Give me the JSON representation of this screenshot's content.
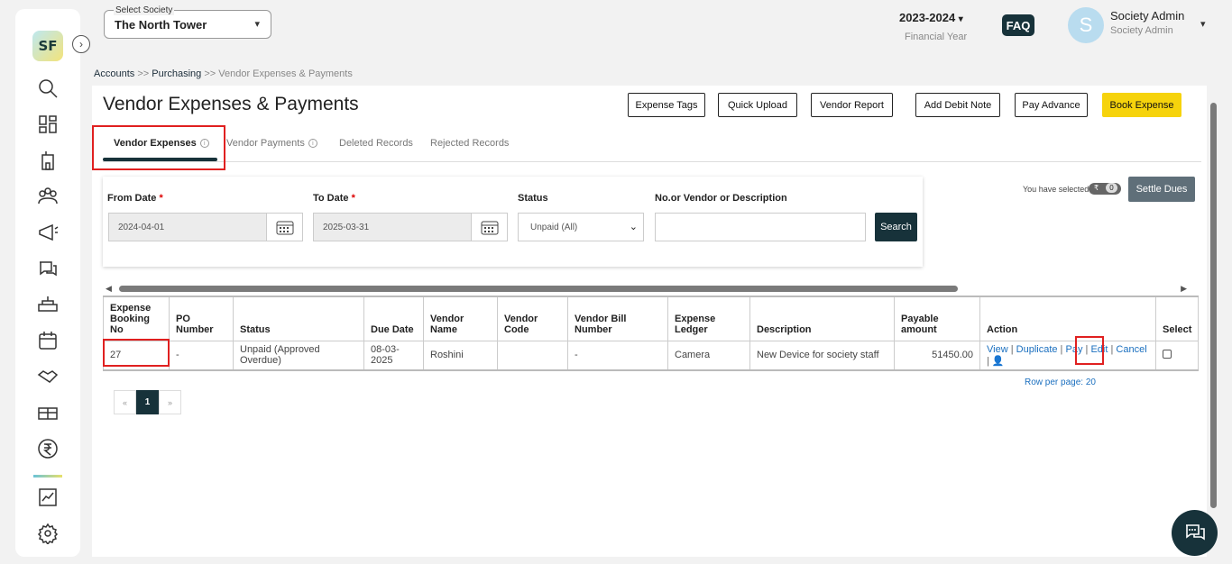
{
  "header": {
    "society_label": "Select Society",
    "society_value": "The North Tower",
    "financial_year": "2023-2024",
    "financial_year_label": "Financial Year",
    "faq_label": "FAQ",
    "avatar_letter": "S",
    "user_name": "Society Admin",
    "user_role": "Society Admin"
  },
  "sidebar": {
    "logo_text": "SF",
    "items": [
      "search-icon",
      "dashboard-icon",
      "building-icon",
      "members-icon",
      "announcement-icon",
      "complaints-icon",
      "facility-icon",
      "calendar-icon",
      "vendors-icon",
      "assets-icon",
      "accounts-icon",
      "reports-icon",
      "settings-icon"
    ]
  },
  "breadcrumb": {
    "accounts": "Accounts",
    "sep1": ">>",
    "purchasing": "Purchasing",
    "sep2": ">>",
    "current": "Vendor Expenses & Payments"
  },
  "page": {
    "title": "Vendor Expenses & Payments",
    "buttons": {
      "expense_tags": "Expense Tags",
      "quick_upload": "Quick Upload",
      "vendor_report": "Vendor Report",
      "add_debit_note": "Add Debit Note",
      "pay_advance": "Pay Advance",
      "book_expense": "Book Expense"
    },
    "tabs": {
      "vendor_expenses": "Vendor Expenses",
      "vendor_payments": "Vendor Payments",
      "deleted_records": "Deleted Records",
      "rejected_records": "Rejected Records"
    }
  },
  "filters": {
    "from_date_label": "From Date",
    "from_date_value": "2024-04-01",
    "to_date_label": "To Date",
    "to_date_value": "2025-03-31",
    "required_mark": "*",
    "status_label": "Status",
    "status_value": "Unpaid (All)",
    "search_label": "No.or Vendor or Description",
    "search_value": "",
    "search_button": "Search"
  },
  "selection": {
    "selected_text": "You have selected",
    "currency_symbol": "₹",
    "selected_count": "0",
    "settle_button": "Settle Dues"
  },
  "table": {
    "headers": {
      "booking_no": "Expense Booking No",
      "po_number": "PO Number",
      "status": "Status",
      "due_date": "Due Date",
      "vendor_name": "Vendor Name",
      "vendor_code": "Vendor Code",
      "vendor_bill_number": "Vendor Bill Number",
      "expense_ledger": "Expense Ledger",
      "description": "Description",
      "payable_amount": "Payable amount",
      "action": "Action",
      "select": "Select"
    },
    "rows": [
      {
        "booking_no": "27",
        "po_number": "-",
        "status": "Unpaid (Approved Overdue)",
        "due_date": "08-03-2025",
        "vendor_name": "Roshini",
        "vendor_code": "",
        "vendor_bill_number": "-",
        "expense_ledger": "Camera",
        "description": "New Device for society staff",
        "payable_amount": "51450.00",
        "actions": {
          "view": "View",
          "duplicate": "Duplicate",
          "pay": "Pay",
          "edit": "Edit",
          "cancel": "Cancel"
        }
      }
    ]
  },
  "pagination": {
    "rows_per_page": "Row per page: 20",
    "prev": "«",
    "current": "1",
    "next": "»"
  },
  "colors": {
    "primary_dark": "#17323a",
    "accent_yellow": "#f6d30c",
    "link_blue": "#1a6fbf",
    "annotation_red": "#e02020"
  }
}
